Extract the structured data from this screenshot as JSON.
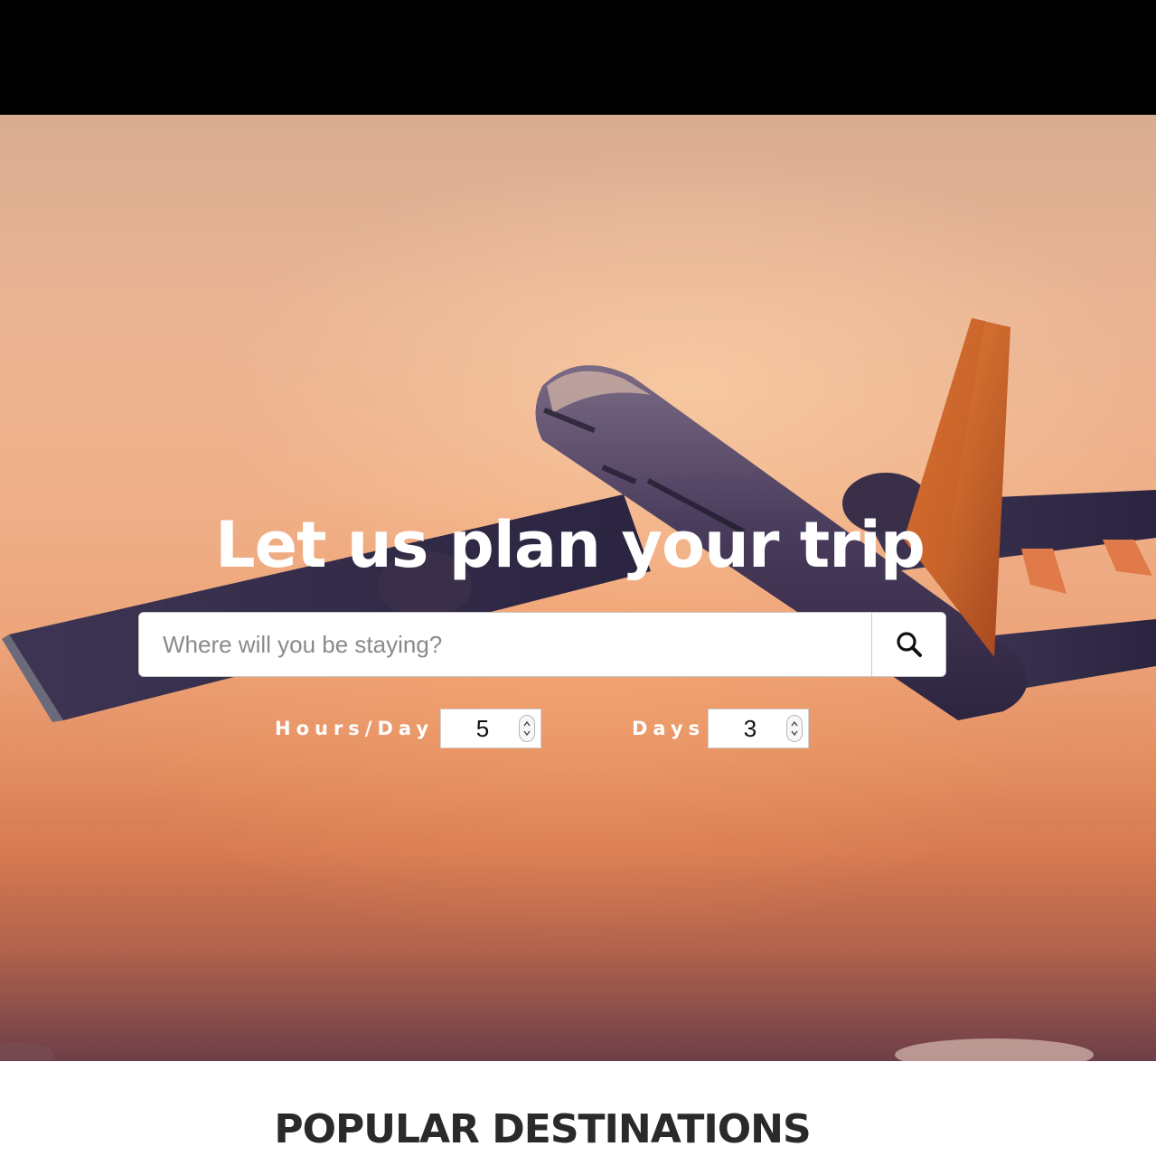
{
  "hero": {
    "title": "Let us plan your trip",
    "search": {
      "placeholder": "Where will you be staying?",
      "value": "",
      "button_icon": "search-icon"
    },
    "hours_per_day": {
      "label": "Hours/Day",
      "value": "5"
    },
    "days": {
      "label": "Days",
      "value": "3"
    },
    "background": "airplane-sunset-photo"
  },
  "sections": {
    "popular_destinations_title": "POPULAR DESTINATIONS"
  },
  "colors": {
    "topbar": "#000000",
    "sky_top": "#d9ad93",
    "sky_mid": "#eda57b",
    "sky_bottom": "#6e3f48",
    "heading_dark": "#2a2a2a"
  }
}
